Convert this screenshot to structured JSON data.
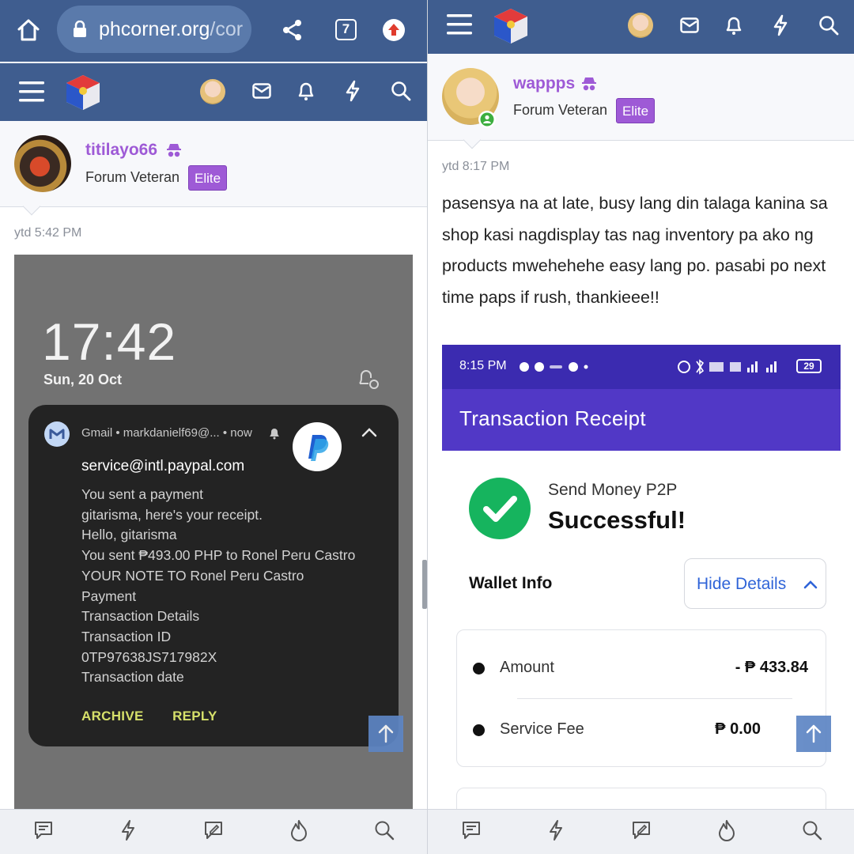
{
  "browser": {
    "url_host": "phcorner.org",
    "url_rest": "/cor",
    "tab_count": "7"
  },
  "left_post": {
    "username": "titilayo66",
    "user_title": "Forum Veteran",
    "badge": "Elite",
    "time": "ytd 5:42 PM",
    "screenshot": {
      "clock": "17:42",
      "date": "Sun, 20 Oct",
      "notification": {
        "app_line": "Gmail • markdanielf69@... • now",
        "title": "service@intl.paypal.com",
        "lines": [
          "You sent a payment",
          "gitarisma, here's your receipt.",
          "Hello, gitarisma",
          "You sent ₱493.00 PHP to Ronel Peru Castro",
          "YOUR NOTE TO Ronel Peru Castro",
          "Payment",
          "Transaction Details",
          "Transaction ID",
          "0TP97638JS717982X",
          "Transaction date"
        ],
        "actions": [
          "ARCHIVE",
          "REPLY"
        ]
      }
    }
  },
  "right_post": {
    "username": "wappps",
    "user_title": "Forum Veteran",
    "badge": "Elite",
    "time": "ytd 8:17 PM",
    "message": "pasensya na at late, busy lang din talaga kanina sa shop kasi nagdisplay tas nag inventory pa ako ng products mwehehehe easy lang po. pasabi po next time paps if rush, thankieee!!",
    "screenshot": {
      "status_time": "8:15 PM",
      "battery": "29",
      "appbar_title": "Transaction Receipt",
      "subtitle": "Send Money P2P",
      "main_status": "Successful!",
      "wallet_info_label": "Wallet Info",
      "hide_details_label": "Hide Details",
      "rows": [
        {
          "label": "Amount",
          "value": "- ₱ 433.84"
        },
        {
          "label": "Service Fee",
          "value": "₱ 0.00"
        }
      ]
    }
  },
  "colors": {
    "header": "#3f5d8f",
    "username": "#9e5ad6",
    "badge": "#9e5ad6",
    "receipt_appbar": "#5138c6",
    "success": "#16b45e",
    "link_blue": "#2f64d8"
  },
  "icons": [
    "home-icon",
    "lock-icon",
    "share-icon",
    "update-icon",
    "menu-icon",
    "logo",
    "mail-icon",
    "bell-icon",
    "bolt-icon",
    "search-icon",
    "chat-icon",
    "edit-icon",
    "fire-icon",
    "arrow-up-icon",
    "gmail-icon",
    "paypal-icon",
    "chevron-up-icon",
    "check-icon",
    "online-dot"
  ]
}
